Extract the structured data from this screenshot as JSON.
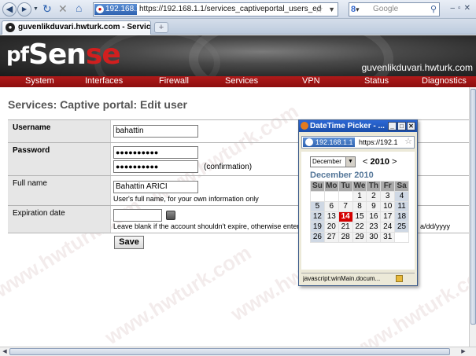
{
  "browser": {
    "url_identity": "192.168.1.1",
    "url": "https://192.168.1.1/services_captiveportal_users_edit.php",
    "search_engine": "Google",
    "tab_title": "guvenlikduvari.hwturk.com - Service..."
  },
  "header": {
    "logo_pf": "pf",
    "logo_sen": "Sen",
    "logo_se": "se",
    "hostname": "guvenlikduvari.hwturk.com"
  },
  "nav": [
    "System",
    "Interfaces",
    "Firewall",
    "Services",
    "VPN",
    "Status",
    "Diagnostics"
  ],
  "page": {
    "title": "Services: Captive portal: Edit user"
  },
  "form": {
    "username_label": "Username",
    "username_value": "bahattin",
    "password_label": "Password",
    "password_mask": "●●●●●●●●●●",
    "password_confirm_mask": "●●●●●●●●●●",
    "confirmation_note": "(confirmation)",
    "fullname_label": "Full name",
    "fullname_value": "Bahattin ARICI",
    "fullname_note": "User's full name, for your own information only",
    "expiration_label": "Expiration date",
    "expiration_value": "",
    "expiration_note": "Leave blank if the account shouldn't expire, otherwise enter the",
    "expiration_note_tail": "a/dd/yyyy",
    "save_label": "Save"
  },
  "watermark": "www.hwturk.com",
  "popup": {
    "title": "DateTime Picker - ...",
    "url_identity": "192.168.1.1",
    "url": "https://192.1",
    "month": "December",
    "year_prev": "<",
    "year": "2010",
    "year_next": ">",
    "heading": "December 2010",
    "days": [
      "Su",
      "Mo",
      "Tu",
      "We",
      "Th",
      "Fr",
      "Sa"
    ],
    "weeks": [
      [
        "",
        "",
        "",
        "1",
        "2",
        "3",
        "4"
      ],
      [
        "5",
        "6",
        "7",
        "8",
        "9",
        "10",
        "11"
      ],
      [
        "12",
        "13",
        "14",
        "15",
        "16",
        "17",
        "18"
      ],
      [
        "19",
        "20",
        "21",
        "22",
        "23",
        "24",
        "25"
      ],
      [
        "26",
        "27",
        "28",
        "29",
        "30",
        "31",
        ""
      ]
    ],
    "today": "14",
    "status": "javascript:winMain.docum..."
  }
}
